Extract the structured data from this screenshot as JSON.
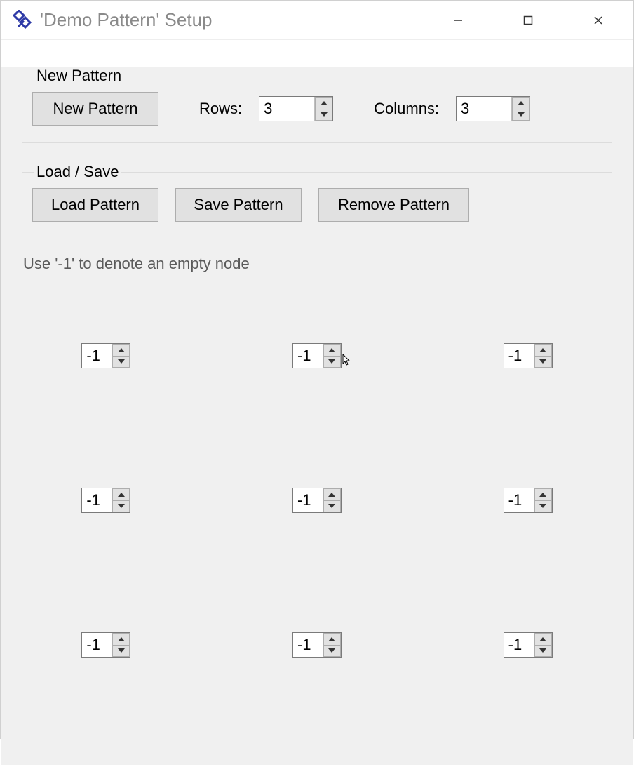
{
  "window": {
    "title": "'Demo Pattern' Setup"
  },
  "newPattern": {
    "legend": "New Pattern",
    "newButton": "New Pattern",
    "rowsLabel": "Rows:",
    "rowsValue": "3",
    "colsLabel": "Columns:",
    "colsValue": "3"
  },
  "loadSave": {
    "legend": "Load / Save",
    "loadButton": "Load Pattern",
    "saveButton": "Save Pattern",
    "removeButton": "Remove Pattern"
  },
  "hint": "Use '-1' to denote an empty node",
  "grid": {
    "cells": [
      "-1",
      "-1",
      "-1",
      "-1",
      "-1",
      "-1",
      "-1",
      "-1",
      "-1"
    ]
  }
}
